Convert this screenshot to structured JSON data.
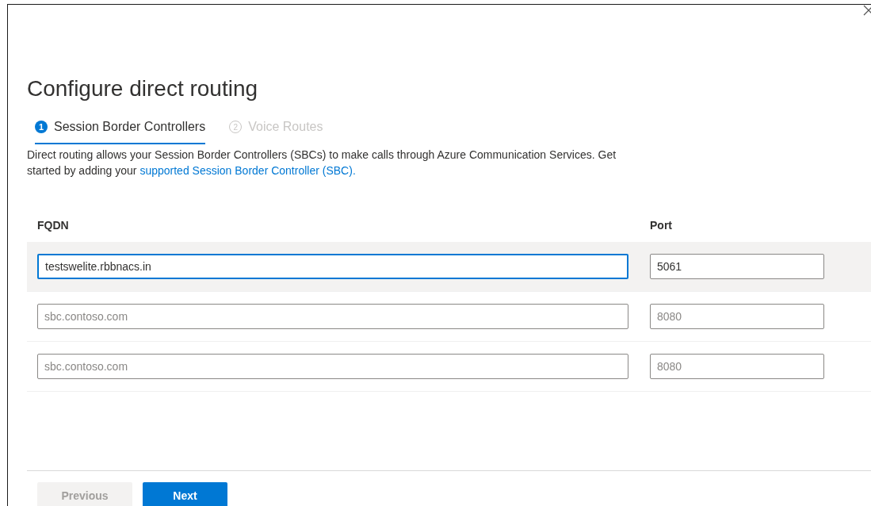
{
  "dialog": {
    "title": "Configure direct routing"
  },
  "steps": [
    {
      "number": "1",
      "label": "Session Border Controllers",
      "selected": true
    },
    {
      "number": "2",
      "label": "Voice Routes",
      "selected": false
    }
  ],
  "description": {
    "text": "Direct routing allows your Session Border Controllers (SBCs) to make calls through Azure Communication Services. Get started by adding your ",
    "link": "supported Session Border Controller (SBC)."
  },
  "table": {
    "columns": [
      "FQDN",
      "Port"
    ],
    "rows": [
      {
        "selected": true,
        "fqdn": {
          "value": "testswelite.rbbnacs.in"
        },
        "port": {
          "value": "5061"
        }
      },
      {
        "selected": false,
        "fqdn": {
          "placeholder": "sbc.contoso.com"
        },
        "port": {
          "placeholder": "8080"
        }
      },
      {
        "selected": false,
        "fqdn": {
          "placeholder": "sbc.contoso.com"
        },
        "port": {
          "placeholder": "8080"
        }
      }
    ]
  },
  "buttons": [
    {
      "label": "Previous",
      "kind": "secondary",
      "disabled": true
    },
    {
      "label": "Next",
      "kind": "primary",
      "disabled": false
    }
  ]
}
